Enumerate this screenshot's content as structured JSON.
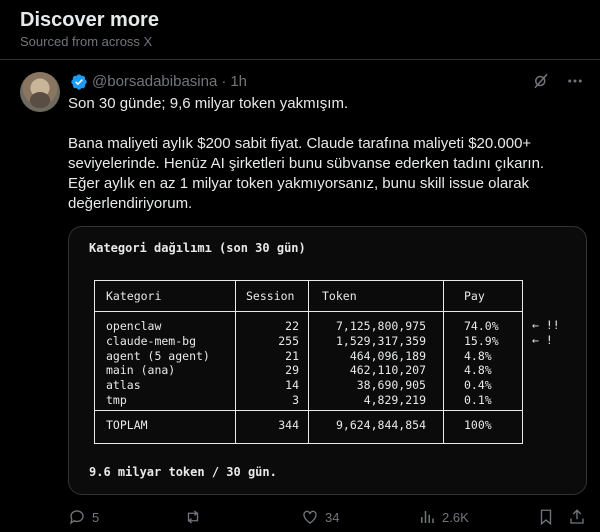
{
  "header": {
    "title": "Discover more",
    "subtitle": "Sourced from across X"
  },
  "post": {
    "handle": "@borsadabibasina",
    "separator": "·",
    "time": "1h",
    "paragraphs": [
      "Son 30 günde; 9,6 milyar token yakmışım.",
      "Bana maliyeti aylık $200 sabit fiyat. Claude tarafına maliyeti $20.000+ seviyelerinde. Henüz AI şirketleri bunu sübvanse ederken tadını çıkarın. Eğer aylık en az 1 milyar token yakmıyorsanız, bunu skill issue olarak değerlendiriyorum."
    ],
    "icons": {
      "grok": "grok-icon",
      "more": "more-icon"
    }
  },
  "media": {
    "title": "Kategori dağılımı (son 30 gün)",
    "footer": "9.6 milyar token / 30 gün.",
    "columns": [
      "Kategori",
      "Session",
      "Token",
      "Pay"
    ],
    "rows": [
      {
        "kategori": "openclaw",
        "session": "22",
        "token": "7,125,800,975",
        "pay": "74.0%",
        "note": "← !!"
      },
      {
        "kategori": "claude-mem-bg",
        "session": "255",
        "token": "1,529,317,359",
        "pay": "15.9%",
        "note": "← !"
      },
      {
        "kategori": "agent (5 agent)",
        "session": "21",
        "token": "464,096,189",
        "pay": "4.8%",
        "note": ""
      },
      {
        "kategori": "main (ana)",
        "session": "29",
        "token": "462,110,207",
        "pay": "4.8%",
        "note": ""
      },
      {
        "kategori": "atlas",
        "session": "14",
        "token": "38,690,905",
        "pay": "0.4%",
        "note": ""
      },
      {
        "kategori": "tmp",
        "session": "3",
        "token": "4,829,219",
        "pay": "0.1%",
        "note": ""
      }
    ],
    "total": {
      "kategori": "TOPLAM",
      "session": "344",
      "token": "9,624,844,854",
      "pay": "100%"
    }
  },
  "actions": {
    "replies": "5",
    "reposts": "",
    "likes": "34",
    "views": "2.6K"
  }
}
